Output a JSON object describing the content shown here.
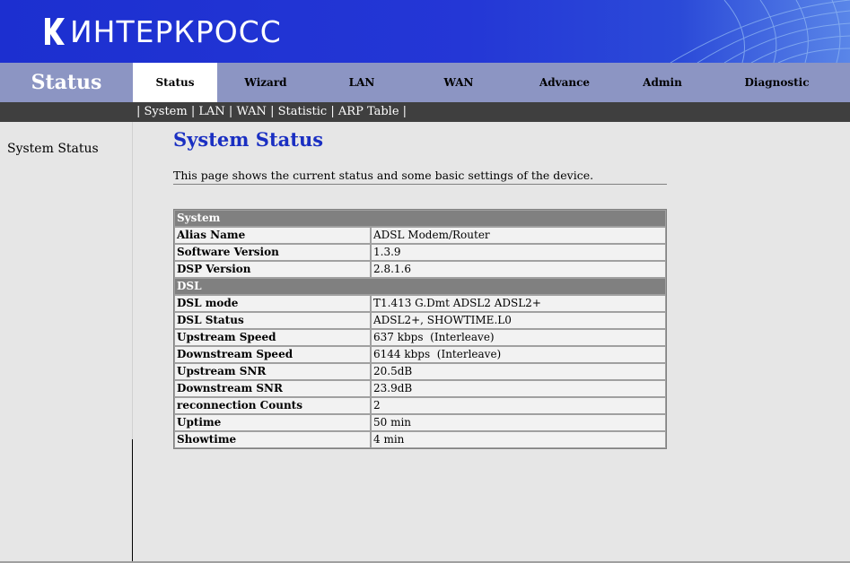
{
  "header": {
    "logo_text": "ИНТЕРКРОСС",
    "colors": {
      "banner": "#1c2fd0",
      "nav": "#8c95c3",
      "subnav": "#3f3f3f",
      "title": "#1a2fc2",
      "section_row": "#808080"
    }
  },
  "nav": {
    "section_title": "Status",
    "tabs": [
      {
        "label": "Status",
        "active": true
      },
      {
        "label": "Wizard"
      },
      {
        "label": "LAN"
      },
      {
        "label": "WAN"
      },
      {
        "label": "Advance"
      },
      {
        "label": "Admin"
      },
      {
        "label": "Diagnostic"
      }
    ]
  },
  "subnav": {
    "sep": "|",
    "items": [
      "System",
      "LAN",
      "WAN",
      "Statistic",
      "ARP Table"
    ]
  },
  "sidebar": {
    "items": [
      "System Status"
    ]
  },
  "main": {
    "title": "System Status",
    "description": "This page shows the current status and some basic settings of the device.",
    "sections": [
      {
        "name": "System",
        "rows": [
          {
            "label": "Alias Name",
            "value": "ADSL Modem/Router"
          },
          {
            "label": "Software Version",
            "value": "1.3.9"
          },
          {
            "label": "DSP Version",
            "value": "2.8.1.6"
          }
        ]
      },
      {
        "name": "DSL",
        "rows": [
          {
            "label": "DSL mode",
            "value": "T1.413 G.Dmt ADSL2 ADSL2+"
          },
          {
            "label": "DSL Status",
            "value": "ADSL2+, SHOWTIME.L0"
          },
          {
            "label": "Upstream Speed",
            "value": "637 kbps  (Interleave)"
          },
          {
            "label": "Downstream Speed",
            "value": "6144 kbps  (Interleave)"
          },
          {
            "label": "Upstream SNR",
            "value": "20.5dB"
          },
          {
            "label": "Downstream SNR",
            "value": "23.9dB"
          },
          {
            "label": "reconnection Counts",
            "value": "2"
          },
          {
            "label": "Uptime",
            "value": "50 min"
          },
          {
            "label": "Showtime",
            "value": "4 min"
          }
        ]
      }
    ]
  }
}
